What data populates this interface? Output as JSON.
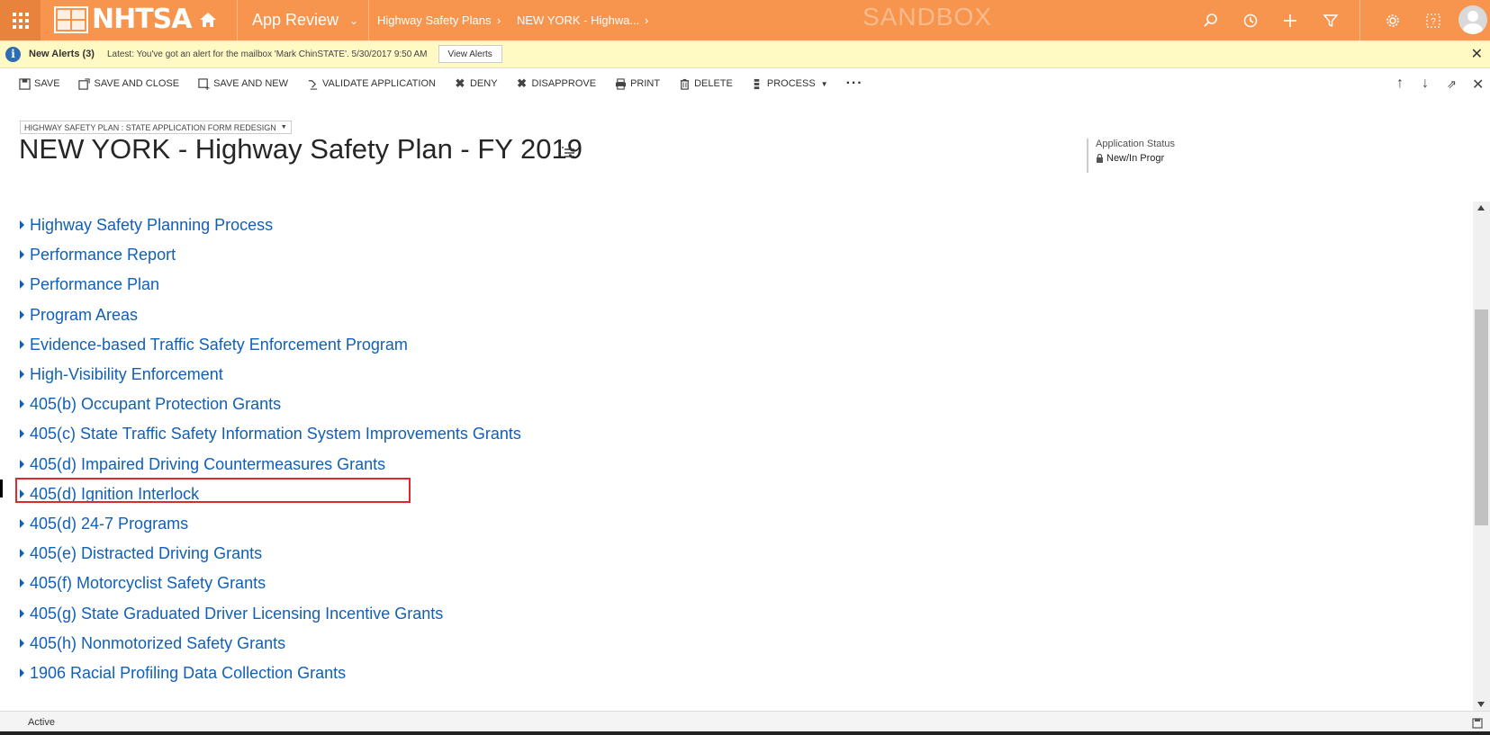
{
  "topbar": {
    "logo_text": "NHTSA",
    "app_name": "App Review",
    "breadcrumb": [
      "Highway Safety Plans",
      "NEW YORK - Highwa..."
    ],
    "watermark": "SANDBOX",
    "background_color": "#f7954f",
    "icons": [
      "search-icon",
      "history-icon",
      "plus-icon",
      "filter-icon",
      "gear-icon",
      "help-icon",
      "user-avatar"
    ]
  },
  "alert": {
    "title": "New Alerts (3)",
    "message": "Latest: You've got an alert for the mailbox 'Mark ChinSTATE'. 5/30/2017 9:50 AM",
    "button_label": "View Alerts",
    "background_color": "#fff9c4"
  },
  "commands": [
    {
      "label": "SAVE",
      "icon": "save-icon"
    },
    {
      "label": "SAVE AND CLOSE",
      "icon": "save-close-icon"
    },
    {
      "label": "SAVE AND NEW",
      "icon": "save-new-icon"
    },
    {
      "label": "VALIDATE APPLICATION",
      "icon": "validate-icon"
    },
    {
      "label": "DENY",
      "icon": "x-icon"
    },
    {
      "label": "DISAPPROVE",
      "icon": "x-icon"
    },
    {
      "label": "PRINT",
      "icon": "print-icon"
    },
    {
      "label": "DELETE",
      "icon": "trash-icon"
    },
    {
      "label": "PROCESS",
      "icon": "process-icon"
    }
  ],
  "form": {
    "selector": "HIGHWAY SAFETY PLAN : STATE APPLICATION FORM REDESIGN",
    "title": "NEW YORK - Highway Safety Plan - FY 2019",
    "status_label": "Application Status",
    "status_value": "New/In Progr"
  },
  "sections": [
    "Highway Safety Planning Process",
    "Performance Report",
    "Performance Plan",
    "Program Areas",
    "Evidence-based Traffic Safety Enforcement Program",
    "High-Visibility Enforcement",
    "405(b) Occupant Protection Grants",
    "405(c) State Traffic Safety Information System Improvements Grants",
    "405(d) Impaired Driving Countermeasures Grants",
    "405(d) Ignition Interlock",
    "405(d) 24-7 Programs",
    "405(e) Distracted Driving Grants",
    "405(f) Motorcyclist Safety Grants",
    "405(g) State Graduated Driver Licensing Incentive Grants",
    "405(h) Nonmotorized Safety Grants",
    "1906 Racial Profiling Data Collection Grants"
  ],
  "highlighted_section_index": 8,
  "footer": {
    "status": "Active"
  }
}
